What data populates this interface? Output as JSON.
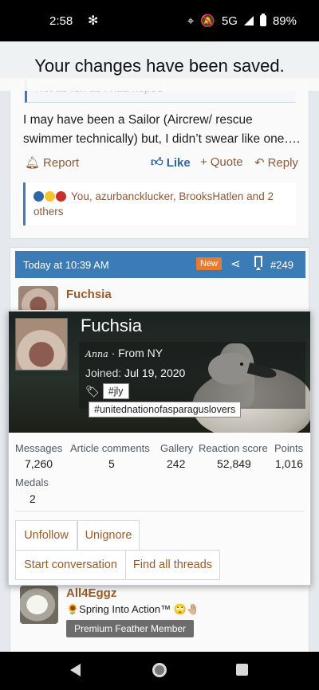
{
  "status": {
    "time": "2:58",
    "network": "5G",
    "battery": "89%"
  },
  "toast": {
    "message": "Your changes have been saved."
  },
  "post1": {
    "quote_text": "Not as fun as I had hoped",
    "body": "I may have been a Sailor (Aircrew/ rescue swimmer technically) but, I didn’t swear like one….",
    "actions": {
      "report": "Report",
      "like": "Like",
      "quote": "Quote",
      "reply": "Reply"
    },
    "reactions": "You, azurbancklucker, BrooksHatlen and 2 others"
  },
  "post2": {
    "date": "Today at 10:39 AM",
    "badge": "New",
    "number": "#249",
    "author": "Fuchsia"
  },
  "member_card": {
    "name": "Fuchsia",
    "signature_name": "Anna",
    "location": "· From NY",
    "joined_label": "Joined:",
    "joined_date": "Jul 19, 2020",
    "tags": [
      "#jly",
      "#unitednationofasparaguslovers"
    ],
    "stats": [
      {
        "label": "Messages",
        "value": "7,260"
      },
      {
        "label": "Article comments",
        "value": "5"
      },
      {
        "label": "Gallery",
        "value": "242"
      },
      {
        "label": "Reaction score",
        "value": "52,849"
      },
      {
        "label": "Points",
        "value": "1,016"
      }
    ],
    "medals_label": "Medals",
    "medals_value": "2",
    "buttons": {
      "unfollow": "Unfollow",
      "unignore": "Unignore",
      "start_conversation": "Start conversation",
      "find_threads": "Find all threads"
    }
  },
  "next_post": {
    "author": "All4Eggz",
    "signature": "🌻Spring Into Action™ 🙄🤚🏼",
    "title": "Premium Feather Member"
  },
  "colors": {
    "accent": "#3c7cb6",
    "link": "#9b5a26",
    "badge_new": "#ea7a2f"
  }
}
